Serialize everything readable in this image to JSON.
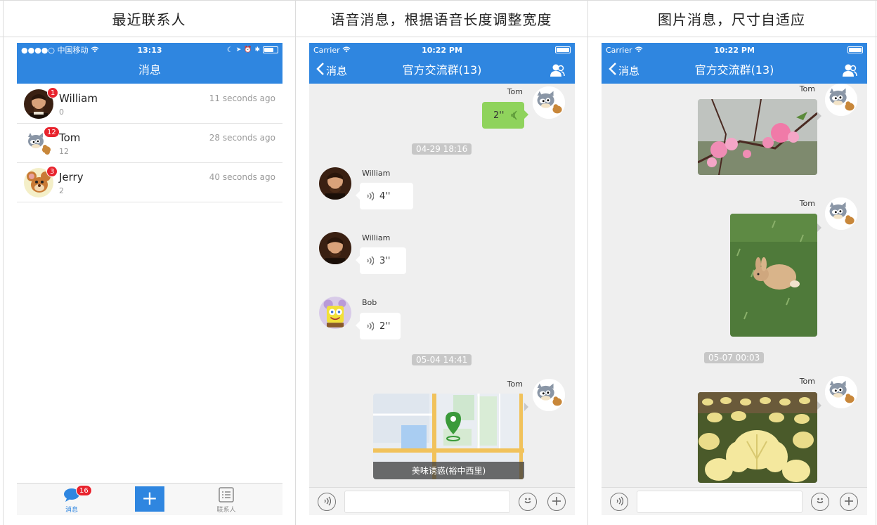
{
  "headers": [
    "最近联系人",
    "语音消息，根据语音长度调整宽度",
    "图片消息，尺寸自适应"
  ],
  "colors": {
    "accent": "#2f86e0",
    "badge": "#e8232d",
    "my_bubble": "#8fd35c",
    "chat_bg": "#efefef"
  },
  "phone1": {
    "status": {
      "carrier": "●●●●○ 中国移动",
      "time": "13:13"
    },
    "nav_title": "消息",
    "conversations": [
      {
        "name": "William",
        "preview": "0",
        "time": "11 seconds ago",
        "badge": "1"
      },
      {
        "name": "Tom",
        "preview": "12",
        "time": "28 seconds ago",
        "badge": "12"
      },
      {
        "name": "Jerry",
        "preview": "2",
        "time": "40 seconds ago",
        "badge": "3"
      }
    ],
    "tabbar": {
      "messages_label": "消息",
      "messages_badge": "16",
      "plus_label": "+",
      "contacts_label": "联系人"
    }
  },
  "phone2": {
    "status": {
      "carrier": "Carrier",
      "time": "10:22 PM"
    },
    "nav_back": "消息",
    "nav_title": "官方交流群(13)",
    "messages": {
      "m1_sender": "Tom",
      "m1_duration": "2''",
      "time1": "04-29 18:16",
      "m2_sender": "William",
      "m2_duration": "4''",
      "m3_sender": "William",
      "m3_duration": "3''",
      "m4_sender": "Bob",
      "m4_duration": "2''",
      "time2": "05-04 14:41",
      "m5_sender": "Tom",
      "m5_location": "美味诱惑(裕中西里)"
    }
  },
  "phone3": {
    "status": {
      "carrier": "Carrier",
      "time": "10:22 PM"
    },
    "nav_back": "消息",
    "nav_title": "官方交流群(13)",
    "messages": {
      "m1_sender": "Tom",
      "m2_sender": "Tom",
      "time1": "05-07 00:03",
      "m3_sender": "Tom"
    }
  }
}
